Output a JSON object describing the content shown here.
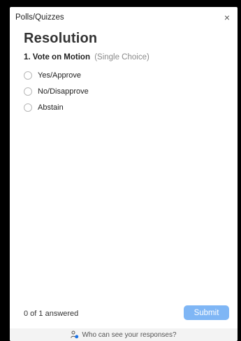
{
  "window": {
    "title": "Polls/Quizzes",
    "close_label": "×"
  },
  "poll": {
    "title": "Resolution",
    "question": {
      "number_and_text": "1. Vote on Motion",
      "type": "(Single Choice)"
    },
    "options": [
      {
        "label": "Yes/Approve",
        "selected": false
      },
      {
        "label": "No/Disapprove",
        "selected": false
      },
      {
        "label": "Abstain",
        "selected": false
      }
    ]
  },
  "footer": {
    "status": "0 of 1 answered",
    "submit_label": "Submit",
    "visibility_link": "Who can see your responses?"
  },
  "colors": {
    "submit_button": "#7fb6f5",
    "visibility_icon_accent": "#1a73e8"
  },
  "icons": {
    "close": "close-icon",
    "visibility": "people-icon"
  }
}
